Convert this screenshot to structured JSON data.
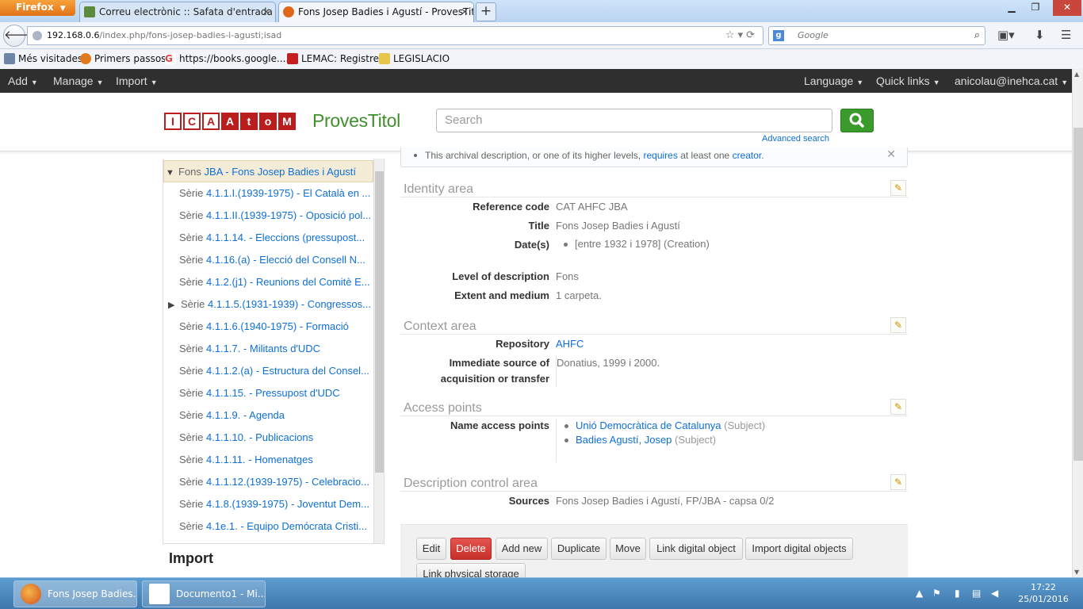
{
  "browser": {
    "menu_label": "Firefox",
    "tabs": [
      {
        "label": "Correu electrònic :: Safata d'entrada (..."
      },
      {
        "label": "Fons Josep Badies i Agustí - ProvesTitol"
      }
    ],
    "url_host": "192.168.0.6",
    "url_path": "/index.php/fons-josep-badies-i-agusti;isad",
    "search_placeholder": "Google",
    "search_engine_glyph": "g",
    "bookmarks": [
      "Més visitades",
      "Primers passos",
      "https://books.google....",
      "LEMAC: Registre",
      "LEGISLACIO"
    ]
  },
  "app": {
    "menu_left": [
      "Add",
      "Manage",
      "Import"
    ],
    "menu_right": [
      "Language",
      "Quick links",
      "anicolau@inehca.cat"
    ],
    "logo_letters": [
      "I",
      "C",
      "A",
      "A",
      "t",
      "o",
      "M"
    ],
    "site_name": "ProvesTitol",
    "search_placeholder": "Search",
    "advanced_search": "Advanced search",
    "accent": "#3b9a2c",
    "logo_red": "#b91d1d"
  },
  "tree": {
    "root": {
      "prefix": "Fons",
      "link": "JBA - Fons Josep Badies i Agustí"
    },
    "items": [
      {
        "prefix": "Sèrie",
        "link": "4.1.1.I.(1939-1975) - El Català en ...",
        "expandable": false
      },
      {
        "prefix": "Sèrie",
        "link": "4.1.1.II.(1939-1975) - Oposició pol...",
        "expandable": false
      },
      {
        "prefix": "Sèrie",
        "link": "4.1.1.14. - Eleccions (pressupost...",
        "expandable": false
      },
      {
        "prefix": "Sèrie",
        "link": "4.1.16.(a) - Elecció del Consell N...",
        "expandable": false
      },
      {
        "prefix": "Sèrie",
        "link": "4.1.2.(j1) - Reunions del Comitè E...",
        "expandable": false
      },
      {
        "prefix": "Sèrie",
        "link": "4.1.1.5.(1931-1939) - Congressos...",
        "expandable": true
      },
      {
        "prefix": "Sèrie",
        "link": "4.1.1.6.(1940-1975) - Formació",
        "expandable": false
      },
      {
        "prefix": "Sèrie",
        "link": "4.1.1.7. - Militants d'UDC",
        "expandable": false
      },
      {
        "prefix": "Sèrie",
        "link": "4.1.1.2.(a) - Estructura del Consel...",
        "expandable": false
      },
      {
        "prefix": "Sèrie",
        "link": "4.1.1.15. - Pressupost d'UDC",
        "expandable": false
      },
      {
        "prefix": "Sèrie",
        "link": "4.1.1.9. - Agenda",
        "expandable": false
      },
      {
        "prefix": "Sèrie",
        "link": "4.1.1.10. - Publicacions",
        "expandable": false
      },
      {
        "prefix": "Sèrie",
        "link": "4.1.1.11. - Homenatges",
        "expandable": false
      },
      {
        "prefix": "Sèrie",
        "link": "4.1.1.12.(1939-1975) - Celebracio...",
        "expandable": false
      },
      {
        "prefix": "Sèrie",
        "link": "4.1.8.(1939-1975) - Joventut Dem...",
        "expandable": false
      },
      {
        "prefix": "Sèrie",
        "link": "4.1e.1. - Equipo Demócrata Cristi...",
        "expandable": false
      }
    ],
    "import_heading": "Import"
  },
  "alert": {
    "text_before": "This archival description, or one of its higher levels,",
    "link1": "requires",
    "text_middle": "at least one",
    "link2": "creator",
    "text_after": "."
  },
  "identity": {
    "heading": "Identity area",
    "reference_code_label": "Reference code",
    "reference_code": "CAT AHFC JBA",
    "title_label": "Title",
    "title": "Fons Josep Badies i Agustí",
    "dates_label": "Date(s)",
    "dates": "[entre 1932 i 1978] (Creation)",
    "level_label": "Level of description",
    "level": "Fons",
    "extent_label": "Extent and medium",
    "extent": "1 carpeta."
  },
  "context": {
    "heading": "Context area",
    "repository_label": "Repository",
    "repository": "AHFC",
    "source_label_1": "Immediate source of",
    "source_label_2": "acquisition or transfer",
    "source": "Donatius, 1999 i 2000."
  },
  "access": {
    "heading": "Access points",
    "name_label": "Name access points",
    "points": [
      {
        "name": "Unió Democràtica de Catalunya",
        "type": "(Subject)"
      },
      {
        "name": "Badies Agustí, Josep",
        "type": "(Subject)"
      }
    ]
  },
  "control": {
    "heading": "Description control area",
    "sources_label": "Sources",
    "sources": "Fons Josep Badies i Agustí, FP/JBA - capsa 0/2"
  },
  "actions": [
    "Edit",
    "Delete",
    "Add new",
    "Duplicate",
    "Move",
    "Link digital object",
    "Import digital objects",
    "Link physical storage"
  ],
  "taskbar": {
    "tasks": [
      "Fons Josep Badies...",
      "Documento1 - Mi..."
    ],
    "time": "17:22",
    "date": "25/01/2016"
  }
}
